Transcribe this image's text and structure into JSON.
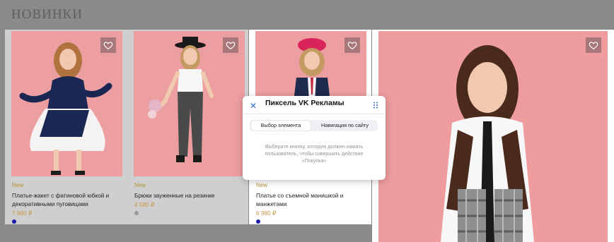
{
  "section_title": "НОВИНКИ",
  "colors": {
    "page_overlay": "#8a8a8a",
    "photo_background": "#ec9ea0",
    "badge": "#b5912f",
    "price": "#c59545",
    "accent_blue": "#2b6fd1"
  },
  "products": [
    {
      "badge": "New",
      "name": "Платье-жакет с фатиновой юбкой и декоративными пуговицами",
      "price": "7 980 ₽",
      "swatch_color": "#1c1ca8"
    },
    {
      "badge": "New",
      "name": "Брюки зауженные на резинке",
      "price": "4 580 ₽",
      "swatch_color": "#9a9a9a"
    },
    {
      "badge": "New",
      "name": "Платье со съемной манишкой и манжетами",
      "price": "6 980 ₽",
      "swatch_color": "#1c1ca8"
    }
  ],
  "popup": {
    "title": "Пиксель VK Рекламы",
    "tabs": [
      "Выбор элемента",
      "Навигация по сайту"
    ],
    "active_tab": "Выбор элемента",
    "hint": "Выберите кнопку, которую должен нажать пользователь, чтобы совершить действие «Покупка»"
  }
}
